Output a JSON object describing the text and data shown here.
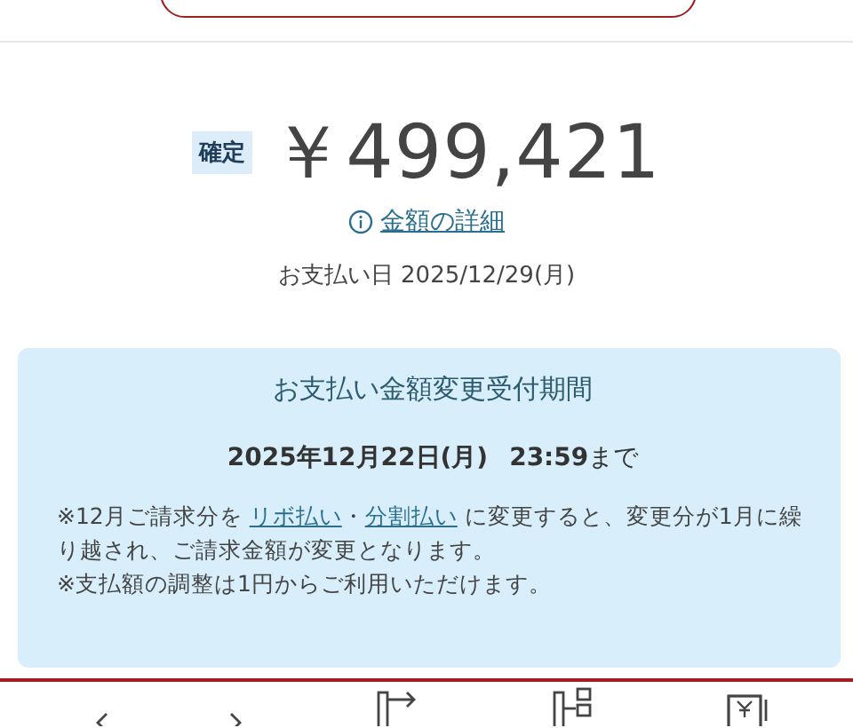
{
  "summary": {
    "status_badge": "確定",
    "amount": "￥499,421",
    "details_link": "金額の詳細",
    "payment_date": "お支払い日 2025/12/29(月)"
  },
  "change_period": {
    "title": "お支払い金額変更受付期間",
    "deadline_date": "2025年12月22日(月)",
    "deadline_time": "23:59",
    "deadline_suffix": "まで",
    "notes": [
      {
        "segments": [
          {
            "kind": "text",
            "text": "※12月ご請求分を "
          },
          {
            "kind": "link",
            "text": "リボ払い"
          },
          {
            "kind": "text",
            "text": "・"
          },
          {
            "kind": "link",
            "text": "分割払い"
          },
          {
            "kind": "text",
            "text": " に変更すると、変更分が1月に繰り越され、ご請求金額が変更となります。"
          }
        ]
      },
      {
        "segments": [
          {
            "kind": "text",
            "text": "※支払額の調整は1円からご利用いただけます。"
          }
        ]
      }
    ]
  },
  "bottom_nav": [
    {
      "kind": "arrow-left"
    },
    {
      "kind": "arrow-right"
    },
    {
      "kind": "transfer"
    },
    {
      "kind": "split"
    },
    {
      "kind": "yen"
    }
  ]
}
